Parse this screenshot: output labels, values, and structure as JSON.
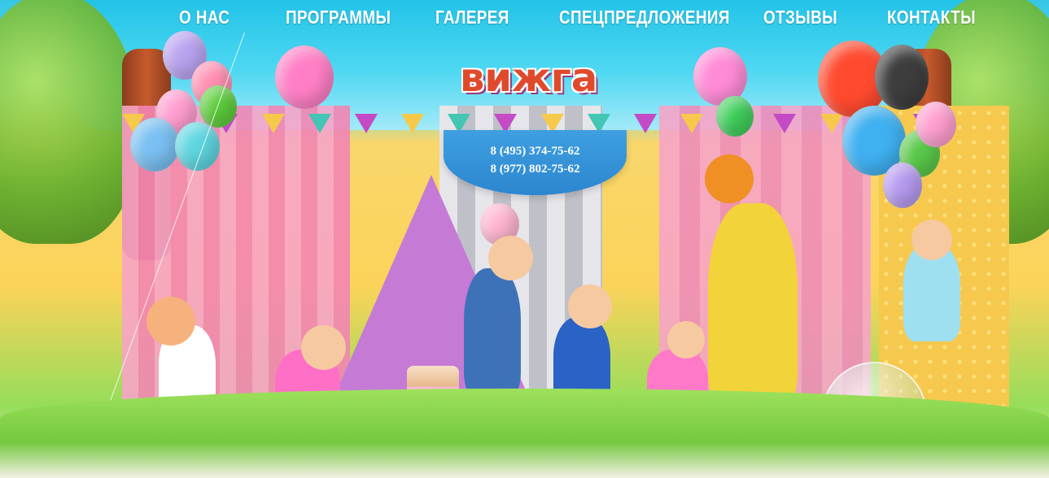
{
  "nav": {
    "items": [
      {
        "label": "О НАС"
      },
      {
        "label": "ПРОГРАММЫ"
      },
      {
        "label": "ГАЛЕРЕЯ"
      },
      {
        "label": "СПЕЦПРЕДЛОЖЕНИЯ"
      },
      {
        "label": "ОТЗЫВЫ"
      },
      {
        "label": "КОНТАКТЫ"
      }
    ]
  },
  "logo": {
    "text": "вижга"
  },
  "contacts": {
    "phones": [
      "8 (495) 374-75-62",
      "8 (977) 802-75-62"
    ]
  },
  "colors": {
    "sky": "#36c7e6",
    "menu_text": "#ffffff",
    "banner": "#2c86cf",
    "logo": "#e04a2c"
  }
}
